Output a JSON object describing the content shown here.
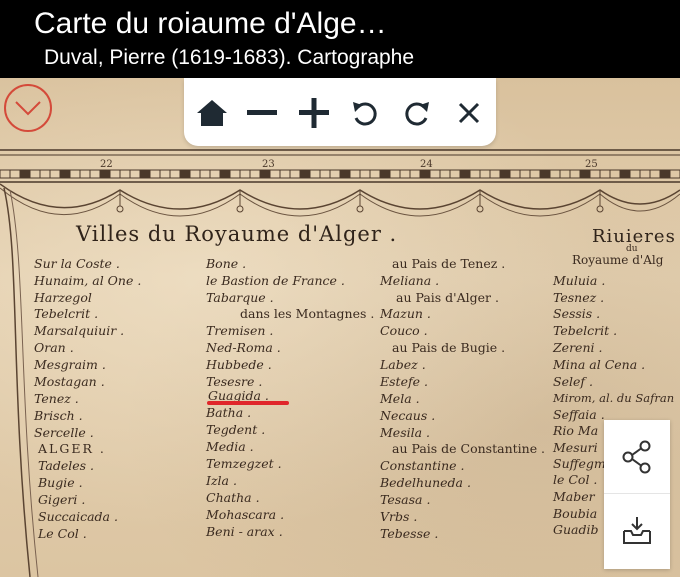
{
  "header": {
    "title": "Carte du roiaume d'Alge…",
    "subtitle": "Duval, Pierre (1619-1683). Cartographe"
  },
  "toolbar": {
    "icons": [
      "home-icon",
      "zoom-out-icon",
      "zoom-in-icon",
      "rotate-left-icon",
      "rotate-right-icon",
      "close-icon"
    ]
  },
  "colors": {
    "accent": "#d44a3a",
    "underline": "#e0262b",
    "ink": "#3a2a1f",
    "paper": "#ddc6a4"
  },
  "map": {
    "scale_numbers": [
      "22",
      "23",
      "24",
      "25"
    ],
    "heading_villes": "Villes   du   Royaume   d'Alger .",
    "heading_rivieres": "Riuieres",
    "heading_rivieres_du": "du",
    "heading_rivieres_royaume": "Royaume d'Alg",
    "col1": [
      "Sur la Coste .",
      "Hunaim, al One .",
      "Harzegol",
      "Tebelcrit .",
      "Marsalquiuir .",
      "Oran .",
      "Mesgraim .",
      "Mostagan .",
      "Tenez .",
      "Brisch .",
      "Sercelle .",
      "ALGER .",
      "Tadeles .",
      "Bugie .",
      "Gigeri .",
      "Succaicada .",
      "Le Col ."
    ],
    "col2": [
      "Bone .",
      "le Bastion de France .",
      "Tabarque .",
      "dans les Montagnes .",
      "Tremisen .",
      "Ned-Roma .",
      "Hubbede .",
      "Tesesre .",
      "Guagida .",
      "Batha .",
      "Tegdent .",
      "Media .",
      "Temzegzet .",
      "Izla .",
      "Chatha .",
      "Mohascara .",
      "Beni - arax ."
    ],
    "col3": [
      "au Pais de Tenez .",
      "Meliana .",
      "au Pais d'Alger .",
      "Mazun .",
      "Couco .",
      "au Pais de Bugie .",
      "Labez .",
      "Estefe .",
      "Mela .",
      "Necaus .",
      "Mesila .",
      "au Pais de Constantine .",
      "Constantine .",
      "Bedelhuneda .",
      "Tesasa .",
      "Vrbs .",
      "Tebesse ."
    ],
    "col4": [
      "Muluia .",
      "Tesnez .",
      "Sessis .",
      "Tebelcrit .",
      "Zereni .",
      "Mina al Cena .",
      "Selef .",
      "Mirom, al. du Safran",
      "Seffaia .",
      "Rio Ma",
      "Mesuri",
      "Suffegm",
      "le Col .",
      "Maber",
      "Boubia",
      "Guadib"
    ]
  },
  "side_panel": {
    "icons": [
      "share-icon",
      "download-icon"
    ]
  }
}
